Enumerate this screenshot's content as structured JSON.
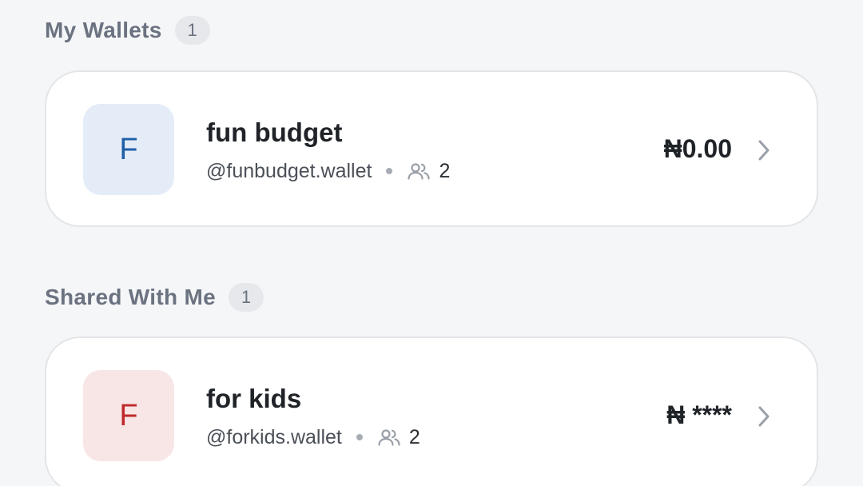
{
  "my_wallets": {
    "title": "My Wallets",
    "count": "1",
    "items": [
      {
        "initial": "F",
        "name": "fun budget",
        "handle": "@funbudget.wallet",
        "members": "2",
        "balance": "₦0.00",
        "avatar_bg": "#e4ecf7",
        "avatar_color": "#1f5fa8"
      }
    ]
  },
  "shared_with_me": {
    "title": "Shared With Me",
    "count": "1",
    "items": [
      {
        "initial": "F",
        "name": "for kids",
        "handle": "@forkids.wallet",
        "members": "2",
        "balance": "₦ ****",
        "avatar_bg": "#f8e5e5",
        "avatar_color": "#c0292b"
      }
    ]
  },
  "icons": {
    "members": "members-icon",
    "chevron": "chevron-right-icon"
  }
}
